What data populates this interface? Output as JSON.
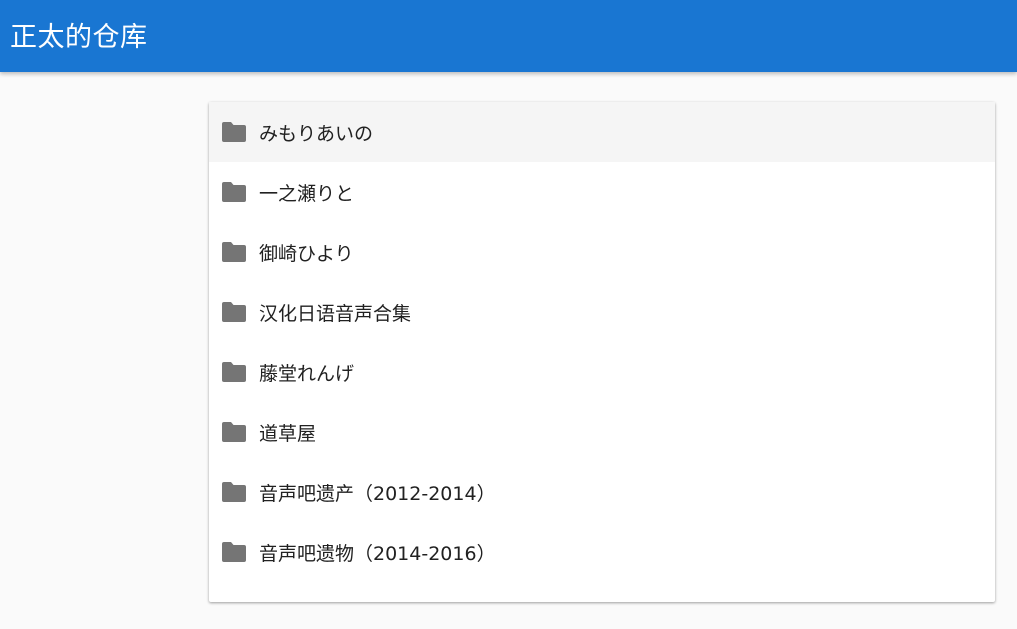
{
  "app": {
    "title": "正太的仓库"
  },
  "colors": {
    "appbar": "#1976d2",
    "folder_icon": "#757575",
    "active_row": "#f5f5f5"
  },
  "folders": {
    "icon": "folder-icon",
    "items": [
      {
        "label": "みもりあいの",
        "active": true
      },
      {
        "label": "一之瀬りと",
        "active": false
      },
      {
        "label": "御崎ひより",
        "active": false
      },
      {
        "label": "汉化日语音声合集",
        "active": false
      },
      {
        "label": "藤堂れんげ",
        "active": false
      },
      {
        "label": "道草屋",
        "active": false
      },
      {
        "label": "音声吧遗产（2012-2014）",
        "active": false
      },
      {
        "label": "音声吧遗物（2014-2016）",
        "active": false
      }
    ]
  }
}
